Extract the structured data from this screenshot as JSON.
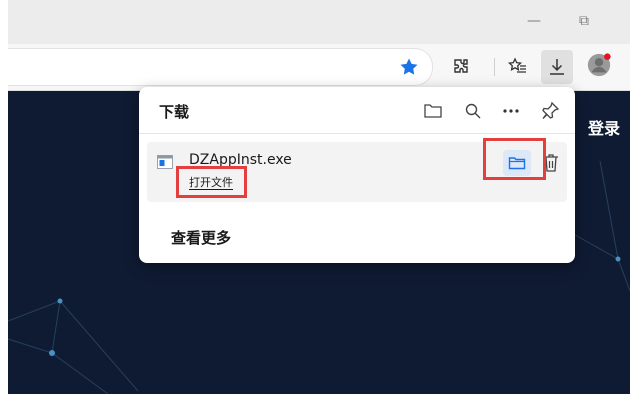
{
  "window": {
    "minimize_glyph": "—",
    "restore_glyph": "⧉"
  },
  "toolbar": {
    "icons": [
      "favorite-star-icon",
      "extensions-icon",
      "favorites-icon",
      "download-icon",
      "profile-avatar"
    ]
  },
  "page": {
    "login_label": "登录"
  },
  "downloads": {
    "title": "下载",
    "header_icons": [
      "open-folder-icon",
      "search-icon",
      "more-icon",
      "pin-icon"
    ],
    "items": [
      {
        "file_name": "DZAppInst.exe",
        "action_label": "打开文件"
      }
    ],
    "see_more_label": "查看更多"
  },
  "colors": {
    "page_background": "#0f1b33",
    "accent_blue": "#1a73e8",
    "highlight_red": "#e53e3e",
    "avatar_badge": "#e81123"
  }
}
